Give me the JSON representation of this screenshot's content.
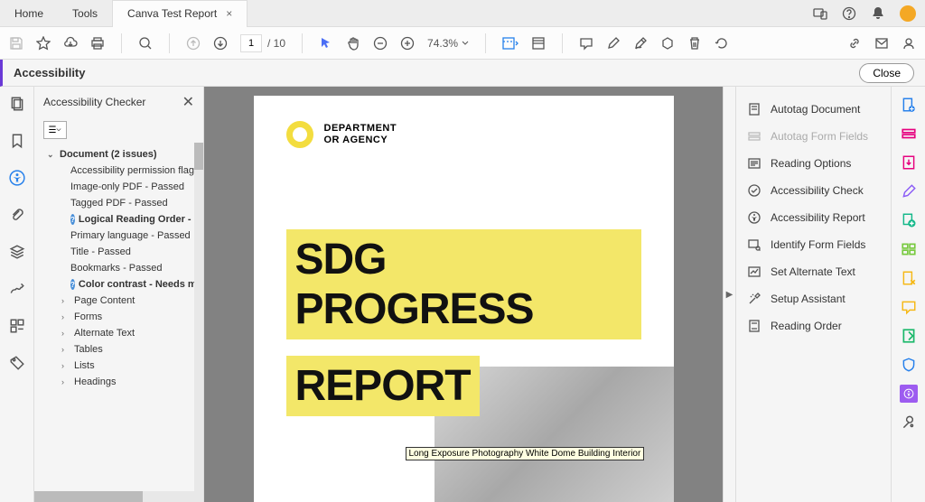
{
  "tabs": {
    "home": "Home",
    "tools": "Tools",
    "doc": "Canva Test Report"
  },
  "toolbar": {
    "page_current": "1",
    "page_total": "/ 10",
    "zoom": "74.3%"
  },
  "panel": {
    "title": "Accessibility",
    "close": "Close"
  },
  "checker": {
    "title": "Accessibility Checker",
    "root": "Document (2 issues)",
    "items": [
      "Accessibility permission flag",
      "Image-only PDF - Passed",
      "Tagged PDF - Passed",
      "Logical Reading Order - Ne",
      "Primary language - Passed",
      "Title - Passed",
      "Bookmarks - Passed",
      "Color contrast - Needs man"
    ],
    "cats": [
      "Page Content",
      "Forms",
      "Alternate Text",
      "Tables",
      "Lists",
      "Headings"
    ]
  },
  "doc": {
    "agency1": "DEPARTMENT",
    "agency2": "OR AGENCY",
    "title1": "SDG PROGRESS",
    "title2": "REPORT",
    "tooltip": "Long Exposure Photography White Dome Building Interior"
  },
  "right_panel": [
    "Autotag Document",
    "Autotag Form Fields",
    "Reading Options",
    "Accessibility Check",
    "Accessibility Report",
    "Identify Form Fields",
    "Set Alternate Text",
    "Setup Assistant",
    "Reading Order"
  ]
}
